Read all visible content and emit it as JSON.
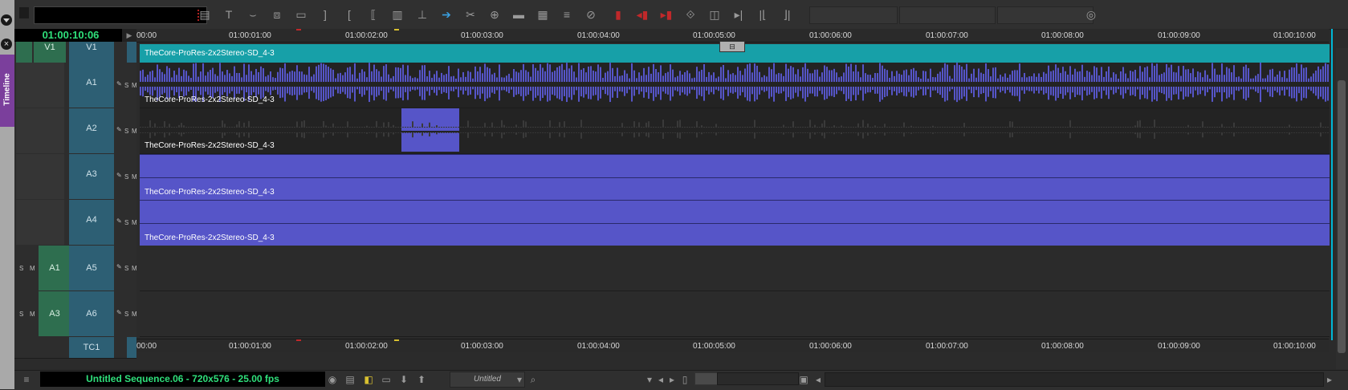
{
  "app": {
    "panel_tab": "Timeline",
    "master_timecode": "01:00:10:06"
  },
  "ruler": {
    "labels": [
      "00:00",
      "01:00:01:00",
      "01:00:02:00",
      "01:00:03:00",
      "01:00:04:00",
      "01:00:05:00",
      "01:00:06:00",
      "01:00:07:00",
      "01:00:08:00",
      "01:00:09:00",
      "01:00:10:00"
    ]
  },
  "tracks": {
    "video": {
      "record": "V1",
      "source": "V1",
      "clip": "TheCore-ProRes-2x2Stereo-SD_4-3"
    },
    "audio": [
      {
        "record": "A1",
        "source": "",
        "clip": "TheCore-ProRes-2x2Stereo-SD_4-3"
      },
      {
        "record": "A2",
        "source": "",
        "clip": "TheCore-ProRes-2x2Stereo-SD_4-3"
      },
      {
        "record": "A3",
        "source": "",
        "clip": "TheCore-ProRes-2x2Stereo-SD_4-3"
      },
      {
        "record": "A4",
        "source": "",
        "clip": "TheCore-ProRes-2x2Stereo-SD_4-3"
      },
      {
        "record": "A5",
        "source": "A1",
        "clip": ""
      },
      {
        "record": "A6",
        "source": "A3",
        "clip": ""
      }
    ],
    "timecode_track": "TC1",
    "solo_label": "S",
    "mute_label": "M"
  },
  "status": {
    "sequence_info": "Untitled Sequence.06 - 720x576 - 25.00 fps",
    "bin_selector": "Untitled"
  },
  "colors": {
    "clip_video": "#17a0a8",
    "clip_audio": "#5655c8",
    "timecode_green": "#2fe07b",
    "record_track": "#2d5f74",
    "source_track": "#2e6e4f",
    "tab_purple": "#7b3f9c"
  },
  "icons": {
    "toolbar": [
      "lift-icon",
      "text-icon",
      "splice-icon",
      "overwrite-icon",
      "matchframe-icon",
      "mark-out-icon",
      "mark-in-icon",
      "mark-clip-icon",
      "segment-mode-icon",
      "extract-icon",
      "top-icon",
      "trim-icon",
      "razor-icon",
      "add-edit-icon",
      "render-icon",
      "effect-icon",
      "audio-mix-icon",
      "clear-marks-icon",
      "record-icon",
      "jump-back-icon",
      "jump-forward-icon",
      "split-icon",
      "go-to-in-icon",
      "go-to-out-icon",
      "trim-left-icon",
      "trim-right-icon",
      "settings-icon"
    ],
    "statusbar": [
      "hamburger-icon",
      "record-target-icon",
      "monitor-icon",
      "color-icon",
      "video-icon",
      "down-arrow-icon",
      "up-arrow-icon",
      "search-icon",
      "chevron-down-icon",
      "prev-icon",
      "next-icon",
      "zoom-icon",
      "fit-icon",
      "scroll-left-icon",
      "scroll-right-icon"
    ]
  }
}
